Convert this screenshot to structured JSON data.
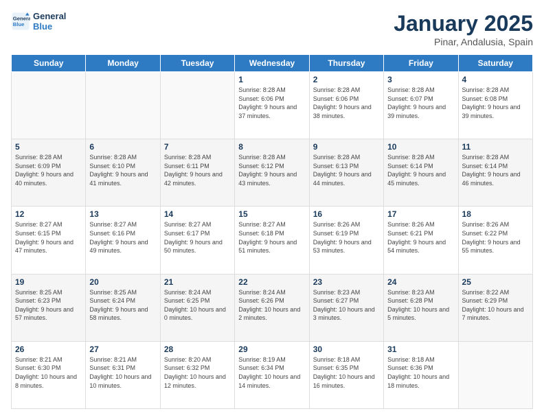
{
  "header": {
    "logo_line1": "General",
    "logo_line2": "Blue",
    "title": "January 2025",
    "subtitle": "Pinar, Andalusia, Spain"
  },
  "days_of_week": [
    "Sunday",
    "Monday",
    "Tuesday",
    "Wednesday",
    "Thursday",
    "Friday",
    "Saturday"
  ],
  "weeks": [
    [
      {
        "day": "",
        "info": ""
      },
      {
        "day": "",
        "info": ""
      },
      {
        "day": "",
        "info": ""
      },
      {
        "day": "1",
        "info": "Sunrise: 8:28 AM\nSunset: 6:06 PM\nDaylight: 9 hours\nand 37 minutes."
      },
      {
        "day": "2",
        "info": "Sunrise: 8:28 AM\nSunset: 6:06 PM\nDaylight: 9 hours\nand 38 minutes."
      },
      {
        "day": "3",
        "info": "Sunrise: 8:28 AM\nSunset: 6:07 PM\nDaylight: 9 hours\nand 39 minutes."
      },
      {
        "day": "4",
        "info": "Sunrise: 8:28 AM\nSunset: 6:08 PM\nDaylight: 9 hours\nand 39 minutes."
      }
    ],
    [
      {
        "day": "5",
        "info": "Sunrise: 8:28 AM\nSunset: 6:09 PM\nDaylight: 9 hours\nand 40 minutes."
      },
      {
        "day": "6",
        "info": "Sunrise: 8:28 AM\nSunset: 6:10 PM\nDaylight: 9 hours\nand 41 minutes."
      },
      {
        "day": "7",
        "info": "Sunrise: 8:28 AM\nSunset: 6:11 PM\nDaylight: 9 hours\nand 42 minutes."
      },
      {
        "day": "8",
        "info": "Sunrise: 8:28 AM\nSunset: 6:12 PM\nDaylight: 9 hours\nand 43 minutes."
      },
      {
        "day": "9",
        "info": "Sunrise: 8:28 AM\nSunset: 6:13 PM\nDaylight: 9 hours\nand 44 minutes."
      },
      {
        "day": "10",
        "info": "Sunrise: 8:28 AM\nSunset: 6:14 PM\nDaylight: 9 hours\nand 45 minutes."
      },
      {
        "day": "11",
        "info": "Sunrise: 8:28 AM\nSunset: 6:14 PM\nDaylight: 9 hours\nand 46 minutes."
      }
    ],
    [
      {
        "day": "12",
        "info": "Sunrise: 8:27 AM\nSunset: 6:15 PM\nDaylight: 9 hours\nand 47 minutes."
      },
      {
        "day": "13",
        "info": "Sunrise: 8:27 AM\nSunset: 6:16 PM\nDaylight: 9 hours\nand 49 minutes."
      },
      {
        "day": "14",
        "info": "Sunrise: 8:27 AM\nSunset: 6:17 PM\nDaylight: 9 hours\nand 50 minutes."
      },
      {
        "day": "15",
        "info": "Sunrise: 8:27 AM\nSunset: 6:18 PM\nDaylight: 9 hours\nand 51 minutes."
      },
      {
        "day": "16",
        "info": "Sunrise: 8:26 AM\nSunset: 6:19 PM\nDaylight: 9 hours\nand 53 minutes."
      },
      {
        "day": "17",
        "info": "Sunrise: 8:26 AM\nSunset: 6:21 PM\nDaylight: 9 hours\nand 54 minutes."
      },
      {
        "day": "18",
        "info": "Sunrise: 8:26 AM\nSunset: 6:22 PM\nDaylight: 9 hours\nand 55 minutes."
      }
    ],
    [
      {
        "day": "19",
        "info": "Sunrise: 8:25 AM\nSunset: 6:23 PM\nDaylight: 9 hours\nand 57 minutes."
      },
      {
        "day": "20",
        "info": "Sunrise: 8:25 AM\nSunset: 6:24 PM\nDaylight: 9 hours\nand 58 minutes."
      },
      {
        "day": "21",
        "info": "Sunrise: 8:24 AM\nSunset: 6:25 PM\nDaylight: 10 hours\nand 0 minutes."
      },
      {
        "day": "22",
        "info": "Sunrise: 8:24 AM\nSunset: 6:26 PM\nDaylight: 10 hours\nand 2 minutes."
      },
      {
        "day": "23",
        "info": "Sunrise: 8:23 AM\nSunset: 6:27 PM\nDaylight: 10 hours\nand 3 minutes."
      },
      {
        "day": "24",
        "info": "Sunrise: 8:23 AM\nSunset: 6:28 PM\nDaylight: 10 hours\nand 5 minutes."
      },
      {
        "day": "25",
        "info": "Sunrise: 8:22 AM\nSunset: 6:29 PM\nDaylight: 10 hours\nand 7 minutes."
      }
    ],
    [
      {
        "day": "26",
        "info": "Sunrise: 8:21 AM\nSunset: 6:30 PM\nDaylight: 10 hours\nand 8 minutes."
      },
      {
        "day": "27",
        "info": "Sunrise: 8:21 AM\nSunset: 6:31 PM\nDaylight: 10 hours\nand 10 minutes."
      },
      {
        "day": "28",
        "info": "Sunrise: 8:20 AM\nSunset: 6:32 PM\nDaylight: 10 hours\nand 12 minutes."
      },
      {
        "day": "29",
        "info": "Sunrise: 8:19 AM\nSunset: 6:34 PM\nDaylight: 10 hours\nand 14 minutes."
      },
      {
        "day": "30",
        "info": "Sunrise: 8:18 AM\nSunset: 6:35 PM\nDaylight: 10 hours\nand 16 minutes."
      },
      {
        "day": "31",
        "info": "Sunrise: 8:18 AM\nSunset: 6:36 PM\nDaylight: 10 hours\nand 18 minutes."
      },
      {
        "day": "",
        "info": ""
      }
    ]
  ]
}
